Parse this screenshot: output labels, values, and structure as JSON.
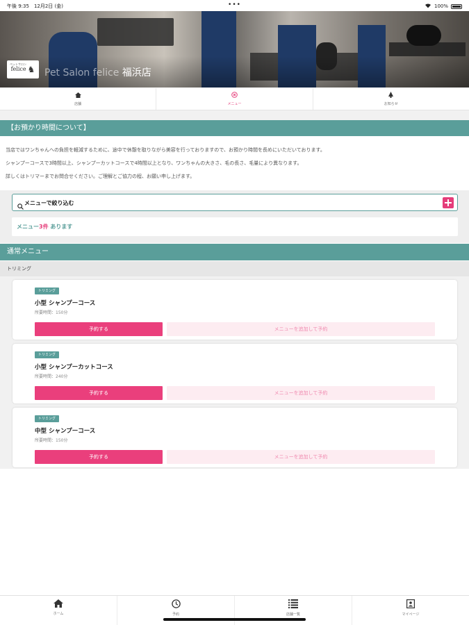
{
  "status_bar": {
    "time": "午後 9:35　12月2日 (金)",
    "dots": "•••",
    "battery": "100%"
  },
  "hero": {
    "logo_sub": "ペットサロン",
    "logo_text": "felice",
    "shop_name_en": "Pet Salon felice",
    "shop_name_branch": "福浜店"
  },
  "top_nav": {
    "items": [
      {
        "label": "店舗",
        "icon": "home-icon"
      },
      {
        "label": "メニュー",
        "icon": "menu-circle-icon",
        "active": true
      },
      {
        "label": "お知らせ",
        "icon": "notice-icon"
      }
    ]
  },
  "notice": {
    "heading": "【お預かり時間について】",
    "lines": [
      "当店ではワンちゃんへの負担を軽減するために、途中で休憩を取りながら美容を行っておりますので、お預かり時間を長めにいただいております。",
      "シャンプーコースで3時間以上、シャンプーカットコースで4時間以上となり、ワンちゃんの大きさ、毛の長さ、毛量により異なります。",
      "詳しくはトリマーまでお問合せください。ご理解とご協力の程、お願い申し上げます。"
    ]
  },
  "filter": {
    "search_label": "メニューで絞り込む",
    "count_prefix": "メニュー",
    "count_number": "3件",
    "count_suffix": " あります"
  },
  "section": {
    "heading": "通常メニュー",
    "category": "トリミング"
  },
  "menu_items": [
    {
      "tag": "トリミング",
      "title": "小型 シャンプーコース",
      "duration": "所要時間：150分",
      "reserve": "予約する",
      "add": "メニューを追加して予約"
    },
    {
      "tag": "トリミング",
      "title": "小型 シャンプーカットコース",
      "duration": "所要時間：240分",
      "reserve": "予約する",
      "add": "メニューを追加して予約"
    },
    {
      "tag": "トリミング",
      "title": "中型 シャンプーコース",
      "duration": "所要時間：150分",
      "reserve": "予約する",
      "add": "メニューを追加して予約"
    }
  ],
  "bottom_tabs": [
    {
      "label": "ホーム",
      "icon": "home-icon"
    },
    {
      "label": "予約",
      "icon": "clock-icon"
    },
    {
      "label": "店舗一覧",
      "icon": "list-icon"
    },
    {
      "label": "マイページ",
      "icon": "mypage-icon"
    }
  ],
  "colors": {
    "accent_teal": "#5a9e9a",
    "accent_pink": "#ea3f7c",
    "pale_pink": "#fdecf1"
  }
}
